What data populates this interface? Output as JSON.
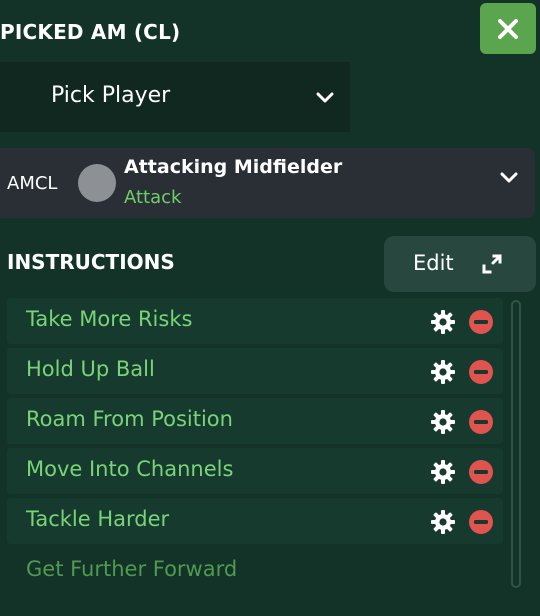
{
  "header": {
    "title": "PICKED AM (CL)"
  },
  "player_select": {
    "value": "Pick Player"
  },
  "role": {
    "position": "AMCL",
    "name": "Attacking Midfielder",
    "duty": "Attack"
  },
  "instructions": {
    "title": "INSTRUCTIONS",
    "edit_label": "Edit",
    "items": [
      {
        "label": "Take More Risks"
      },
      {
        "label": "Hold Up Ball"
      },
      {
        "label": "Roam From Position"
      },
      {
        "label": "Move Into Channels"
      },
      {
        "label": "Tackle Harder"
      },
      {
        "label": "Get Further Forward"
      }
    ]
  },
  "icons": {
    "close": "close-icon",
    "chevron": "chevron-down-icon",
    "expand": "expand-icon",
    "settings": "gear-icon",
    "remove": "remove-icon"
  },
  "colors": {
    "background": "#133329",
    "close_button": "#5aa54e",
    "instruction_text": "#79d477",
    "duty_text": "#6fce6a",
    "remove": "#e0534f"
  }
}
